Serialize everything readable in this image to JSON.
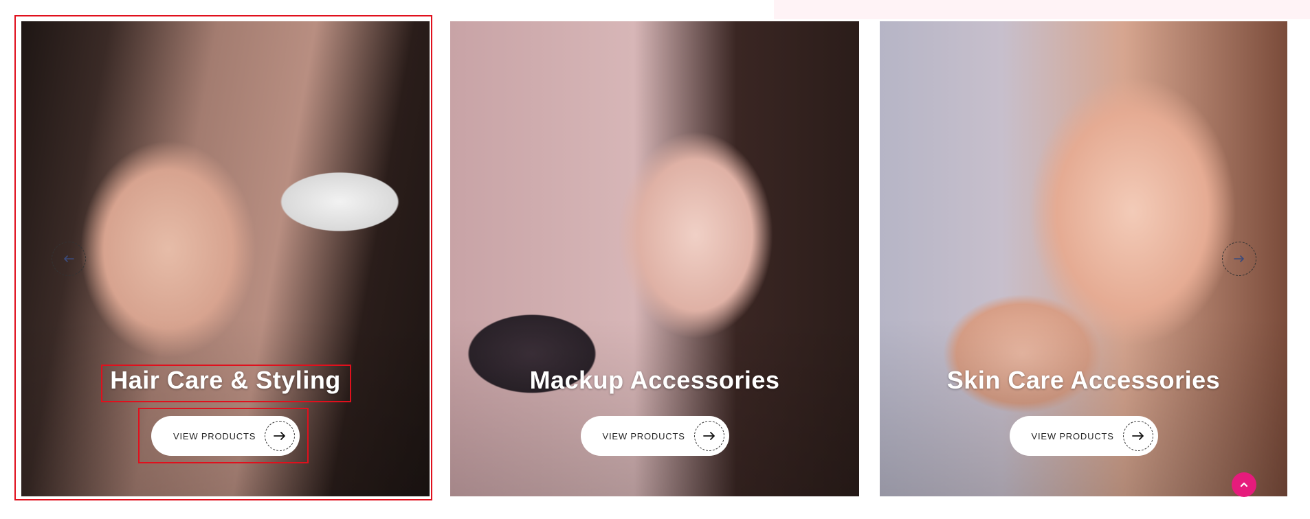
{
  "categories": [
    {
      "title": "Hair Care & Styling",
      "button_label": "VIEW PRODUCTS"
    },
    {
      "title": "Mackup Accessories",
      "button_label": "VIEW PRODUCTS"
    },
    {
      "title": "Skin Care Accessories",
      "button_label": "VIEW PRODUCTS"
    }
  ],
  "icons": {
    "prev": "arrow-left-icon",
    "next": "arrow-right-icon",
    "button_arrow": "arrow-right-icon",
    "scroll_top": "chevron-up-icon"
  },
  "colors": {
    "accent": "#e61b7c",
    "highlight": "#e0101d",
    "nav_arrow": "#3b4a7a"
  }
}
